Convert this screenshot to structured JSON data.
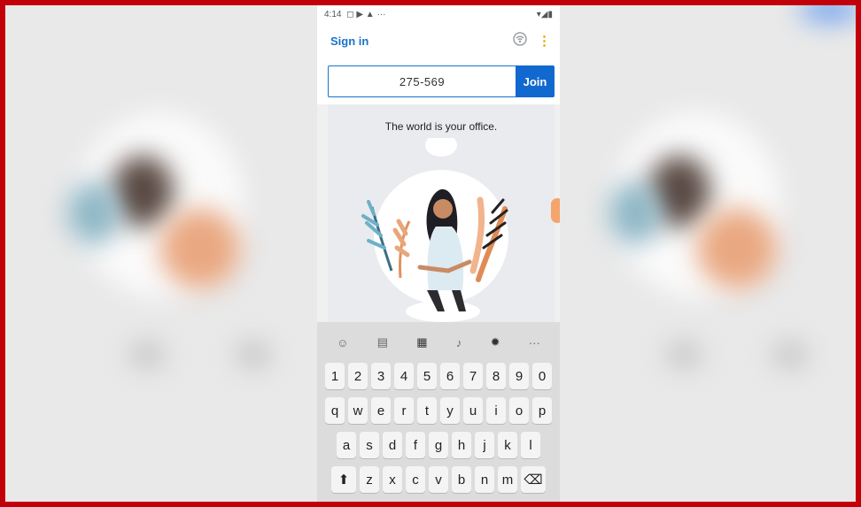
{
  "status_bar": {
    "time": "4:14",
    "icons_left": "◻ ▶ ▲ ···",
    "icons_right": "▾◢▮"
  },
  "app_bar": {
    "sign_in_label": "Sign in",
    "wifi_icon": "wifi-icon",
    "menu_icon": "kebab-menu-icon",
    "menu_glyph": "⋮"
  },
  "meeting": {
    "id_value": "275-569",
    "join_label": "Join"
  },
  "hero": {
    "tagline": "The world is your office."
  },
  "keyboard": {
    "toolbar": [
      {
        "name": "emoji-icon",
        "glyph": "☺"
      },
      {
        "name": "sticker-icon",
        "glyph": "▤"
      },
      {
        "name": "clipboard-icon",
        "glyph": "▦"
      },
      {
        "name": "microphone-icon",
        "glyph": "♪"
      },
      {
        "name": "settings-icon",
        "glyph": "✹"
      },
      {
        "name": "more-icon",
        "glyph": "···"
      }
    ],
    "row_numbers": [
      "1",
      "2",
      "3",
      "4",
      "5",
      "6",
      "7",
      "8",
      "9",
      "0"
    ],
    "row_top": [
      "q",
      "w",
      "e",
      "r",
      "t",
      "y",
      "u",
      "i",
      "o",
      "p"
    ],
    "row_middle": [
      "a",
      "s",
      "d",
      "f",
      "g",
      "h",
      "j",
      "k",
      "l"
    ],
    "row_bottom": [
      "z",
      "x",
      "c",
      "v",
      "b",
      "n",
      "m"
    ],
    "shift_glyph": "⬆",
    "backspace_glyph": "⌫"
  },
  "colors": {
    "accent": "#1168cf",
    "frame": "#c2000a",
    "brand_link": "#1a73c9"
  }
}
